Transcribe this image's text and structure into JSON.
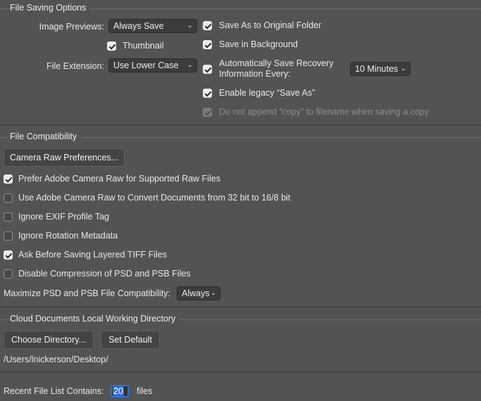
{
  "file_saving": {
    "title": "File Saving Options",
    "image_previews_label": "Image Previews:",
    "image_previews_value": "Always Save",
    "thumbnail_label": "Thumbnail",
    "file_extension_label": "File Extension:",
    "file_extension_value": "Use Lower Case",
    "save_as_original_label": "Save As to Original Folder",
    "save_in_background_label": "Save in Background",
    "auto_save_line1": "Automatically Save Recovery",
    "auto_save_line2": "Information Every:",
    "auto_save_interval": "10 Minutes",
    "legacy_save_as_label": "Enable legacy “Save As”",
    "no_append_copy_label": "Do not append “copy” to filename when saving a copy"
  },
  "file_compat": {
    "title": "File Compatibility",
    "camera_raw_prefs_button": "Camera Raw Preferences...",
    "options": [
      {
        "label": "Prefer Adobe Camera Raw for Supported Raw Files",
        "checked": true
      },
      {
        "label": "Use Adobe Camera Raw to Convert Documents from 32 bit to 16/8 bit",
        "checked": false
      },
      {
        "label": "Ignore EXIF Profile Tag",
        "checked": false
      },
      {
        "label": "Ignore Rotation Metadata",
        "checked": false
      },
      {
        "label": "Ask Before Saving Layered TIFF Files",
        "checked": true
      },
      {
        "label": "Disable Compression of PSD and PSB Files",
        "checked": false
      }
    ],
    "maximize_label": "Maximize PSD and PSB File Compatibility:",
    "maximize_value": "Always"
  },
  "cloud": {
    "title": "Cloud Documents Local Working Directory",
    "choose_button": "Choose Directory...",
    "default_button": "Set Default",
    "path": "/Users/lnickerson/Desktop/"
  },
  "recent": {
    "label": "Recent File List Contains:",
    "value": "20",
    "suffix": "files"
  },
  "colors": {
    "background": "#535353",
    "accent": "#2d6ed4"
  },
  "icons": {
    "select_chevron": "chevron-down-icon",
    "checkbox": "checkmark-icon"
  }
}
